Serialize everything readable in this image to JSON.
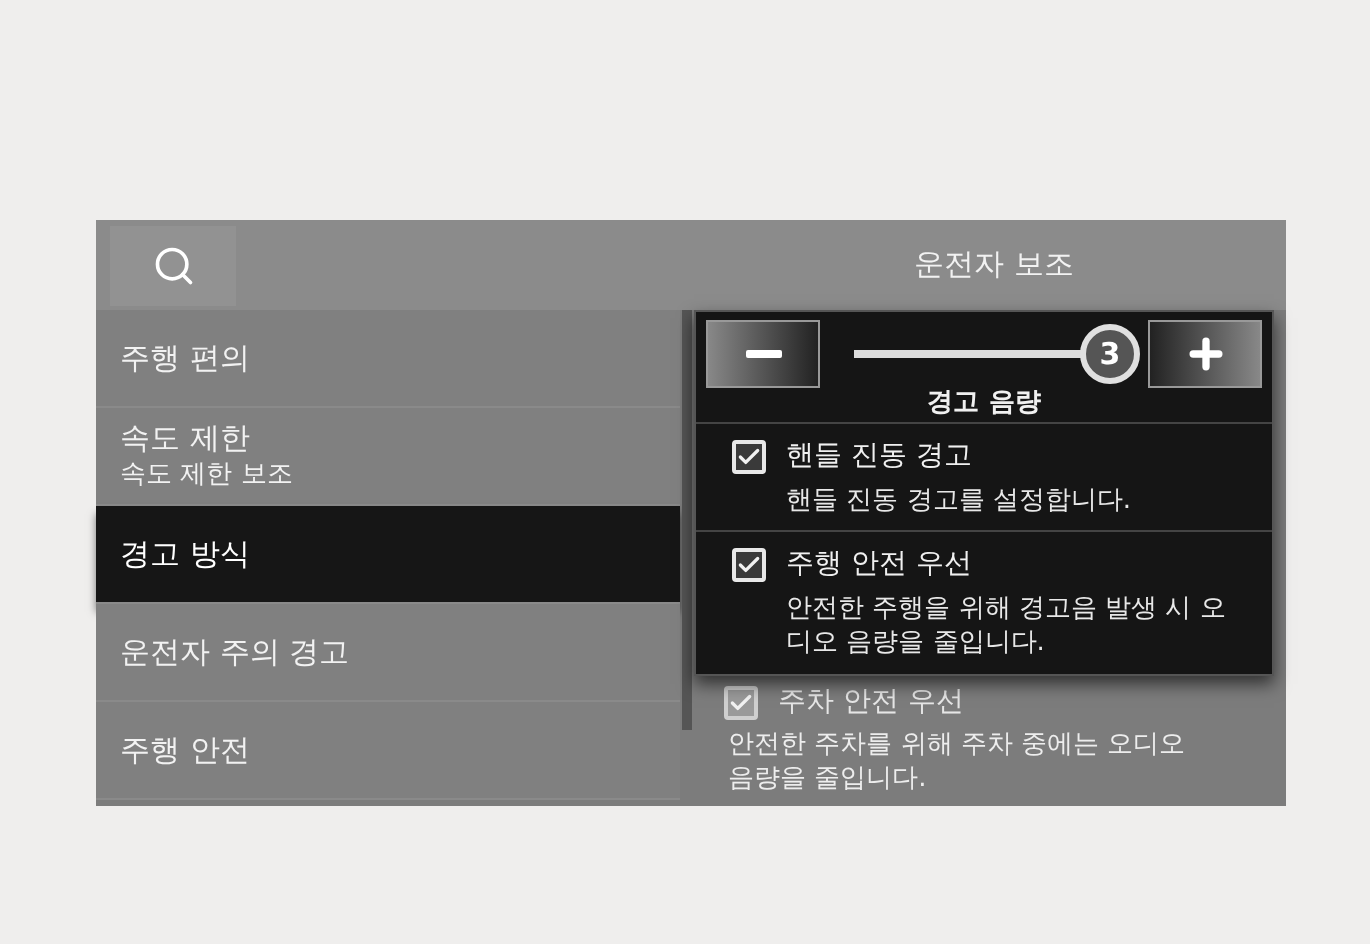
{
  "header": {
    "title": "운전자 보조"
  },
  "menu": [
    {
      "label": "주행 편의",
      "selected": false
    },
    {
      "label": "속도 제한",
      "sublabel": "속도 제한 보조",
      "selected": false
    },
    {
      "label": "경고 방식",
      "selected": true
    },
    {
      "label": "운전자 주의 경고",
      "selected": false
    },
    {
      "label": "주행 안전",
      "selected": false
    }
  ],
  "options": [
    {
      "label": "주차 안전 우선",
      "description": "안전한 주차를 위해 주차 중에는 오디오 음량을 줄입니다.",
      "checked": true
    }
  ],
  "popup": {
    "volume": {
      "label": "경고 음량",
      "value": "3",
      "level": 1
    },
    "options": [
      {
        "label": "핸들 진동 경고",
        "description": "핸들 진동 경고를 설정합니다.",
        "checked": true
      },
      {
        "label": "주행 안전 우선",
        "description": "안전한 주행을 위해 경고음 발생 시 오디오 음량을 줄입니다.",
        "checked": true
      }
    ]
  }
}
